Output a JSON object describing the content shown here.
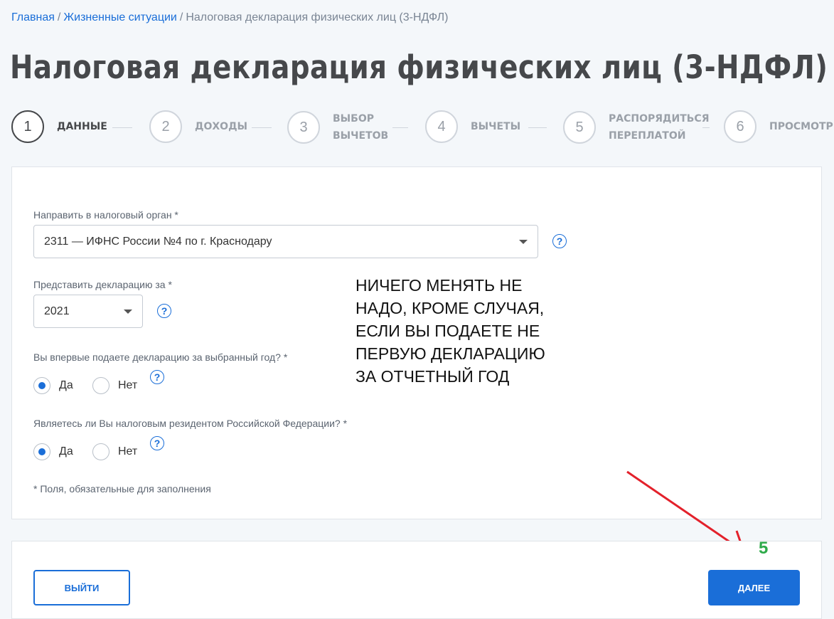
{
  "breadcrumb": {
    "home": "Главная",
    "sep1": "/",
    "life": "Жизненные ситуации",
    "sep2": "/",
    "current": "Налоговая декларация физических лиц (3-НДФЛ)"
  },
  "page_title": "Налоговая декларация физических лиц (3-НДФЛ)",
  "steps": [
    {
      "num": "1",
      "label": "ДАННЫЕ",
      "active": true
    },
    {
      "num": "2",
      "label": "ДОХОДЫ",
      "active": false
    },
    {
      "num": "3",
      "label_l1": "ВЫБОР",
      "label_l2": "ВЫЧЕТОВ",
      "active": false
    },
    {
      "num": "4",
      "label": "ВЫЧЕТЫ",
      "active": false
    },
    {
      "num": "5",
      "label_l1": "РАСПОРЯДИТЬСЯ",
      "label_l2": "ПЕРЕПЛАТОЙ",
      "active": false
    },
    {
      "num": "6",
      "label": "ПРОСМОТР",
      "active": false
    }
  ],
  "form": {
    "tax_office": {
      "label": "Направить в налоговый орган *",
      "value": "2311 — ИФНС России №4 по г. Краснодару"
    },
    "year": {
      "label": "Представить декларацию за *",
      "value": "2021"
    },
    "first_time": {
      "label": "Вы впервые подаете декларацию за выбранный год? *",
      "yes": "Да",
      "no": "Нет",
      "selected": "Да"
    },
    "resident": {
      "label": "Являетесь ли Вы налоговым резидентом Российской Федерации? *",
      "yes": "Да",
      "no": "Нет",
      "selected": "Да"
    },
    "required_note": "* Поля, обязательные для заполнения",
    "help_glyph": "?"
  },
  "annotation": {
    "lines": [
      "НИЧЕГО МЕНЯТЬ НЕ",
      "НАДО, КРОМЕ СЛУЧАЯ,",
      "ЕСЛИ ВЫ ПОДАЕТЕ НЕ",
      "ПЕРВУЮ ДЕКЛАРАЦИЮ",
      "ЗА ОТЧЕТНЫЙ ГОД"
    ],
    "step_number": "5",
    "arrow_color": "#e3212b",
    "step_number_color": "#2eaa4a"
  },
  "actions": {
    "exit": "ВЫЙТИ",
    "next": "ДАЛЕЕ"
  },
  "colors": {
    "accent": "#1a6ed8",
    "background": "#f4f7fa",
    "title": "#46484b"
  }
}
